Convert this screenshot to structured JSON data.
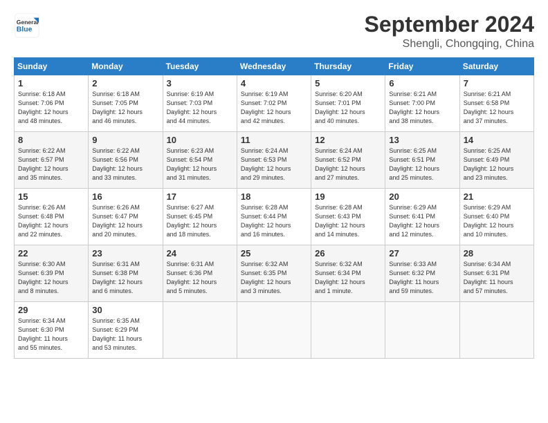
{
  "header": {
    "logo_general": "General",
    "logo_blue": "Blue",
    "month": "September 2024",
    "location": "Shengli, Chongqing, China"
  },
  "weekdays": [
    "Sunday",
    "Monday",
    "Tuesday",
    "Wednesday",
    "Thursday",
    "Friday",
    "Saturday"
  ],
  "weeks": [
    [
      {
        "day": "1",
        "info": "Sunrise: 6:18 AM\nSunset: 7:06 PM\nDaylight: 12 hours\nand 48 minutes."
      },
      {
        "day": "2",
        "info": "Sunrise: 6:18 AM\nSunset: 7:05 PM\nDaylight: 12 hours\nand 46 minutes."
      },
      {
        "day": "3",
        "info": "Sunrise: 6:19 AM\nSunset: 7:03 PM\nDaylight: 12 hours\nand 44 minutes."
      },
      {
        "day": "4",
        "info": "Sunrise: 6:19 AM\nSunset: 7:02 PM\nDaylight: 12 hours\nand 42 minutes."
      },
      {
        "day": "5",
        "info": "Sunrise: 6:20 AM\nSunset: 7:01 PM\nDaylight: 12 hours\nand 40 minutes."
      },
      {
        "day": "6",
        "info": "Sunrise: 6:21 AM\nSunset: 7:00 PM\nDaylight: 12 hours\nand 38 minutes."
      },
      {
        "day": "7",
        "info": "Sunrise: 6:21 AM\nSunset: 6:58 PM\nDaylight: 12 hours\nand 37 minutes."
      }
    ],
    [
      {
        "day": "8",
        "info": "Sunrise: 6:22 AM\nSunset: 6:57 PM\nDaylight: 12 hours\nand 35 minutes."
      },
      {
        "day": "9",
        "info": "Sunrise: 6:22 AM\nSunset: 6:56 PM\nDaylight: 12 hours\nand 33 minutes."
      },
      {
        "day": "10",
        "info": "Sunrise: 6:23 AM\nSunset: 6:54 PM\nDaylight: 12 hours\nand 31 minutes."
      },
      {
        "day": "11",
        "info": "Sunrise: 6:24 AM\nSunset: 6:53 PM\nDaylight: 12 hours\nand 29 minutes."
      },
      {
        "day": "12",
        "info": "Sunrise: 6:24 AM\nSunset: 6:52 PM\nDaylight: 12 hours\nand 27 minutes."
      },
      {
        "day": "13",
        "info": "Sunrise: 6:25 AM\nSunset: 6:51 PM\nDaylight: 12 hours\nand 25 minutes."
      },
      {
        "day": "14",
        "info": "Sunrise: 6:25 AM\nSunset: 6:49 PM\nDaylight: 12 hours\nand 23 minutes."
      }
    ],
    [
      {
        "day": "15",
        "info": "Sunrise: 6:26 AM\nSunset: 6:48 PM\nDaylight: 12 hours\nand 22 minutes."
      },
      {
        "day": "16",
        "info": "Sunrise: 6:26 AM\nSunset: 6:47 PM\nDaylight: 12 hours\nand 20 minutes."
      },
      {
        "day": "17",
        "info": "Sunrise: 6:27 AM\nSunset: 6:45 PM\nDaylight: 12 hours\nand 18 minutes."
      },
      {
        "day": "18",
        "info": "Sunrise: 6:28 AM\nSunset: 6:44 PM\nDaylight: 12 hours\nand 16 minutes."
      },
      {
        "day": "19",
        "info": "Sunrise: 6:28 AM\nSunset: 6:43 PM\nDaylight: 12 hours\nand 14 minutes."
      },
      {
        "day": "20",
        "info": "Sunrise: 6:29 AM\nSunset: 6:41 PM\nDaylight: 12 hours\nand 12 minutes."
      },
      {
        "day": "21",
        "info": "Sunrise: 6:29 AM\nSunset: 6:40 PM\nDaylight: 12 hours\nand 10 minutes."
      }
    ],
    [
      {
        "day": "22",
        "info": "Sunrise: 6:30 AM\nSunset: 6:39 PM\nDaylight: 12 hours\nand 8 minutes."
      },
      {
        "day": "23",
        "info": "Sunrise: 6:31 AM\nSunset: 6:38 PM\nDaylight: 12 hours\nand 6 minutes."
      },
      {
        "day": "24",
        "info": "Sunrise: 6:31 AM\nSunset: 6:36 PM\nDaylight: 12 hours\nand 5 minutes."
      },
      {
        "day": "25",
        "info": "Sunrise: 6:32 AM\nSunset: 6:35 PM\nDaylight: 12 hours\nand 3 minutes."
      },
      {
        "day": "26",
        "info": "Sunrise: 6:32 AM\nSunset: 6:34 PM\nDaylight: 12 hours\nand 1 minute."
      },
      {
        "day": "27",
        "info": "Sunrise: 6:33 AM\nSunset: 6:32 PM\nDaylight: 11 hours\nand 59 minutes."
      },
      {
        "day": "28",
        "info": "Sunrise: 6:34 AM\nSunset: 6:31 PM\nDaylight: 11 hours\nand 57 minutes."
      }
    ],
    [
      {
        "day": "29",
        "info": "Sunrise: 6:34 AM\nSunset: 6:30 PM\nDaylight: 11 hours\nand 55 minutes."
      },
      {
        "day": "30",
        "info": "Sunrise: 6:35 AM\nSunset: 6:29 PM\nDaylight: 11 hours\nand 53 minutes."
      },
      {
        "day": "",
        "info": ""
      },
      {
        "day": "",
        "info": ""
      },
      {
        "day": "",
        "info": ""
      },
      {
        "day": "",
        "info": ""
      },
      {
        "day": "",
        "info": ""
      }
    ]
  ]
}
